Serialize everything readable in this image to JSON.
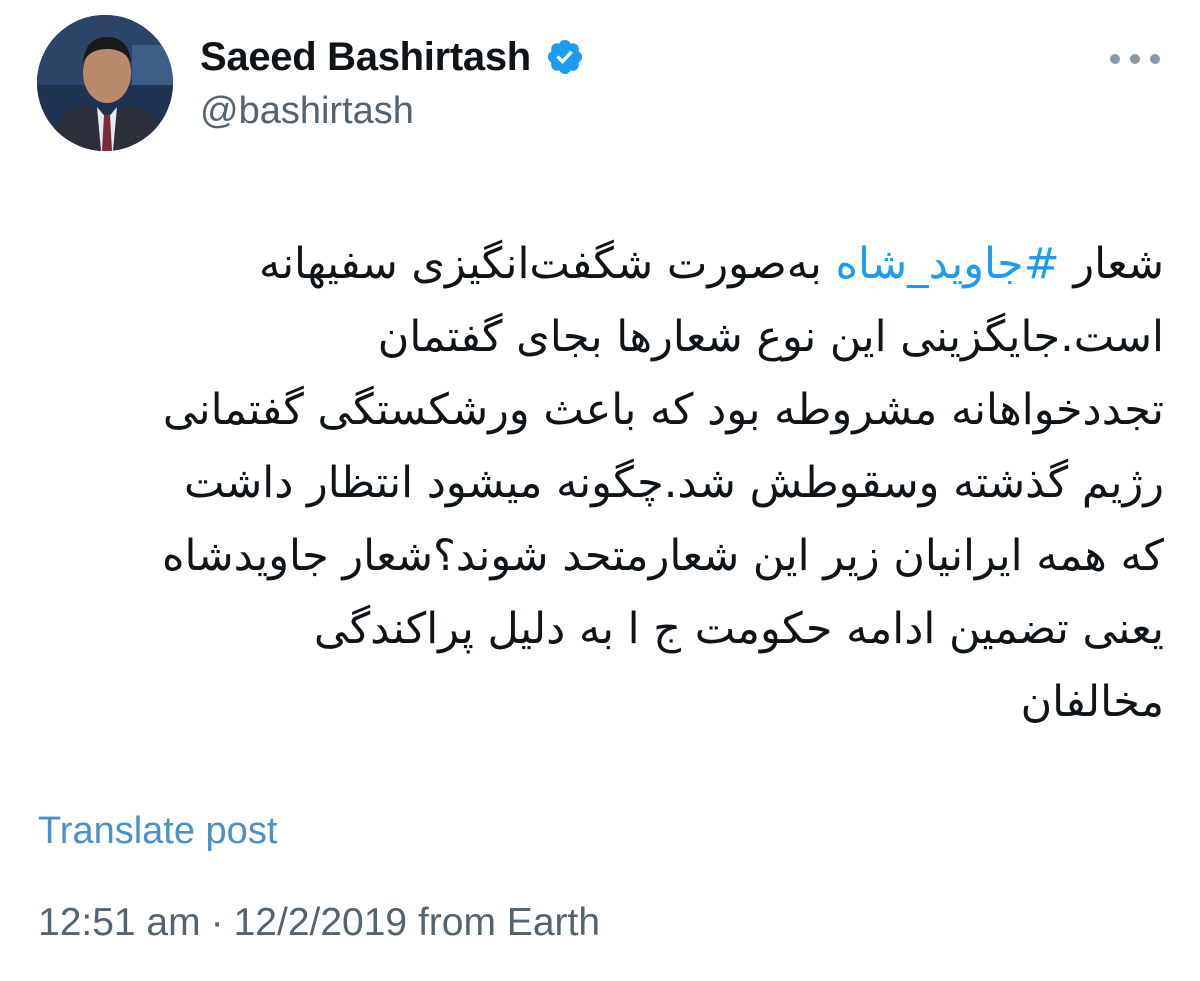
{
  "author": {
    "display_name": "Saeed Bashirtash",
    "handle": "@bashirtash",
    "verified": true,
    "verified_color": "#1d9bf0"
  },
  "icons": {
    "more": "more-options-icon",
    "verified": "verified-badge-icon"
  },
  "post": {
    "lines": [
      {
        "before": "شعار ",
        "hashtag": "#جاوید_شاه",
        "after": " به‌صورت شگفت‌انگیزی سفیهانه"
      },
      {
        "before": "است.جایگزینی این نوع شعارها بجای گفتمان",
        "hashtag": "",
        "after": ""
      },
      {
        "before": "تجددخواهانه مشروطه بود که باعث ورشکستگی گفتمانی",
        "hashtag": "",
        "after": ""
      },
      {
        "before": "رژیم گذشته وسقوطش شد.چگونه میشود انتظار داشت",
        "hashtag": "",
        "after": ""
      },
      {
        "before": "که همه ایرانیان زیر این شعارمتحد شوند؟شعار جاویدشاه",
        "hashtag": "",
        "after": ""
      },
      {
        "before": "یعنی تضمین ادامه حکومت ج ا به دلیل پراکندگی",
        "hashtag": "",
        "after": ""
      },
      {
        "before": "مخالفان",
        "hashtag": "",
        "after": ""
      }
    ],
    "hashtag_color": "#1d9bf0"
  },
  "translate_label": "Translate post",
  "meta": {
    "time": "12:51 am",
    "separator": "·",
    "date": "12/2/2019",
    "source": "from Earth"
  }
}
